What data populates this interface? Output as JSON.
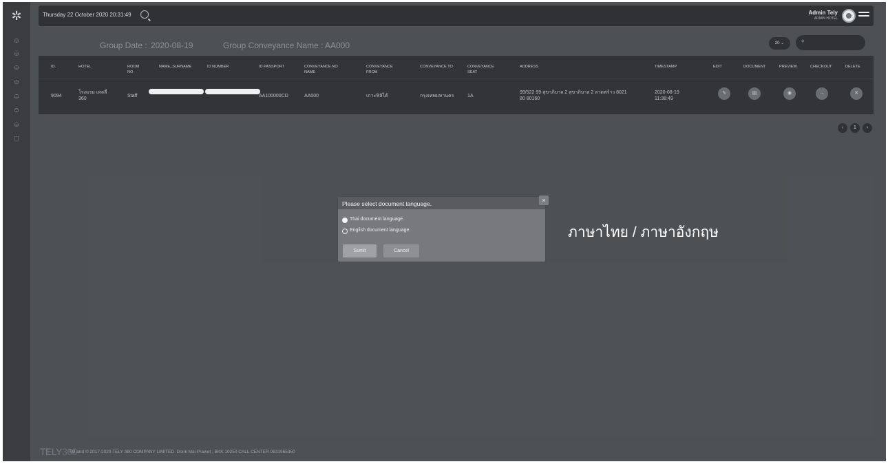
{
  "header": {
    "datetime": "Thursday 22 October 2020 20:31:49",
    "admin_name": "Admin Tely",
    "admin_role": "ADMIN HOTEL"
  },
  "group": {
    "date_label": "Group Date :",
    "date_value": "2020-08-19",
    "conveyance_label": "Group Conveyance Name :",
    "conveyance_value": "AA000"
  },
  "controls": {
    "page_size": "20 ⌄"
  },
  "table": {
    "headers": [
      "ID.",
      "HOTEL",
      "ROOM NO",
      "NAME_SURNAME",
      "ID NUMBER",
      "ID PASSPORT",
      "CONVEYANCE NO NAME",
      "CONVEYANCE FROM",
      "CONVEYANCE TO",
      "CONVEYANCE SEAT",
      "ADDRESS",
      "TIMESTAMP",
      "EDIT",
      "DOCUMENT",
      "PREVIEW",
      "CHECKOUT",
      "DELETE"
    ],
    "row": {
      "id": "9094",
      "hotel": "โรงแรม เทลลี่ 360",
      "room": "Staff",
      "passport": "AA100000CD",
      "conveyance_name": "AA000",
      "from": "เกาะฟิลิได้",
      "to": "กรุงเทพมหานคร",
      "seat": "1A",
      "address": "99/522 99 สุขาภิบาล 2 สุขาภิบาล 2 ลาดพร้าว 8021 80 80160",
      "timestamp": "2020-08-19 11:38:49"
    }
  },
  "pagination": {
    "prev": "‹",
    "page": "1",
    "next": "›"
  },
  "footer": {
    "logo_a": "TELY",
    "logo_b": "360",
    "text": "TM and © 2017-2020 TELY 360 COMPANY LIMITED. Donk Mai Prawet , BKK 10250 CALL CENTER 0631965360"
  },
  "modal": {
    "title": "Please select document language.",
    "close": "×",
    "option_thai": "Thai document language.",
    "option_english": "English document language.",
    "submit": "Sumit",
    "cancel": "Cancel"
  },
  "annotation": "ภาษาไทย / ภาษาอังกฤษ",
  "icons": {
    "sidebar": [
      "users-icon",
      "users-icon",
      "users-icon",
      "users-icon",
      "users-icon",
      "users-icon",
      "users-icon",
      "clipboard-icon"
    ],
    "actions": [
      "edit-icon",
      "document-icon",
      "preview-icon",
      "checkout-icon",
      "delete-icon"
    ]
  }
}
